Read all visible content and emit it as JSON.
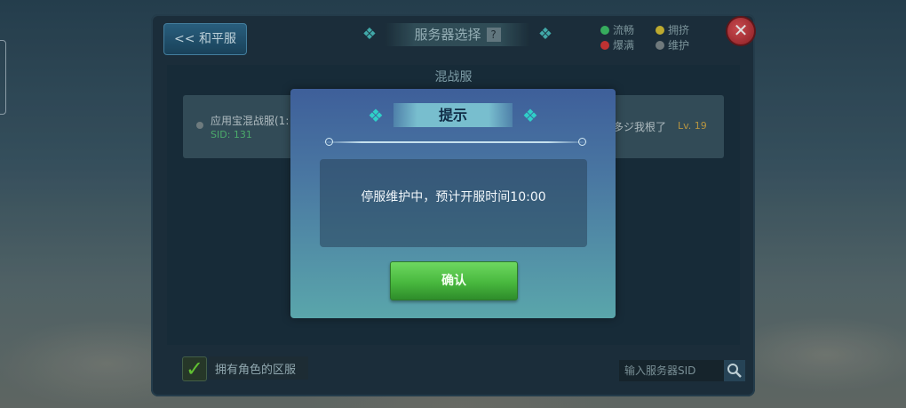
{
  "header": {
    "back_label": "<< 和平服",
    "title": "服务器选择",
    "help_glyph": "?",
    "close_glyph": "✕"
  },
  "legend": [
    {
      "label": "流畅",
      "color": "#3ec46a"
    },
    {
      "label": "拥挤",
      "color": "#d8c236"
    },
    {
      "label": "爆满",
      "color": "#d83a3a"
    },
    {
      "label": "维护",
      "color": "#7f8a8e"
    }
  ],
  "section": {
    "title": "混战服"
  },
  "server": {
    "name": "应用宝混战服(1:",
    "sid": "SID: 131",
    "role": "多ジ我根了",
    "level": "Lv. 19"
  },
  "footer": {
    "checkbox_checked": true,
    "checkbox_label": "拥有角色的区服",
    "search_placeholder": "输入服务器SID"
  },
  "dialog": {
    "title": "提示",
    "message": "停服维护中，预计开服时间10:00",
    "confirm_label": "确认"
  }
}
